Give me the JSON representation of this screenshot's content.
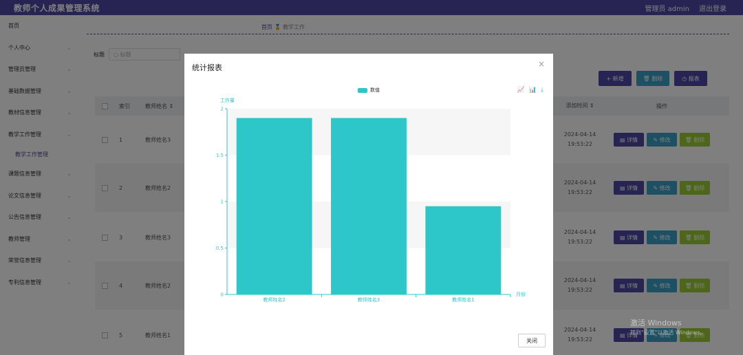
{
  "header": {
    "title": "教师个人成果管理系统",
    "admin": "管理员 admin",
    "logout": "退出登录"
  },
  "sidebar": {
    "items": [
      {
        "label": "首页",
        "chev": ""
      },
      {
        "label": "个人中心",
        "chev": "⌄"
      },
      {
        "label": "管理员管理",
        "chev": "⌄"
      },
      {
        "label": "基础数据管理",
        "chev": "⌄"
      },
      {
        "label": "教材信息管理",
        "chev": "⌄"
      },
      {
        "label": "教学工作管理",
        "chev": "⌄"
      }
    ],
    "sub_item": "教学工作管理",
    "items2": [
      {
        "label": "课题信息管理",
        "chev": "⌄"
      },
      {
        "label": "论文信息管理",
        "chev": "⌄"
      },
      {
        "label": "公告信息管理",
        "chev": "⌄"
      },
      {
        "label": "教师管理",
        "chev": "⌄"
      },
      {
        "label": "荣誉信息管理",
        "chev": "⌄"
      },
      {
        "label": "专利信息管理",
        "chev": "⌄"
      }
    ]
  },
  "breadcrumb": {
    "home": "首页",
    "sep": "🏅",
    "current": "教学工作"
  },
  "search": {
    "label": "标题",
    "placeholder": "标题"
  },
  "toolbar": {
    "add": "+ 新增",
    "delete": "🗑 删除",
    "report": "◷ 报表"
  },
  "table": {
    "headers": {
      "index": "索引",
      "name": "教师姓名 ⇕",
      "time": "添加时间 ⇕",
      "ops": "操作"
    },
    "rows": [
      {
        "index": "1",
        "name": "教师姓名3",
        "time": "2024-04-14 19:53:22"
      },
      {
        "index": "2",
        "name": "教师姓名2",
        "time": "2024-04-14 19:53:22"
      },
      {
        "index": "3",
        "name": "教师姓名3",
        "time": "2024-04-14 19:53:22"
      },
      {
        "index": "4",
        "name": "教师姓名2",
        "time": "2024-04-14 19:53:22"
      },
      {
        "index": "5",
        "name": "教师姓名1",
        "time": "2024-04-14 19:53:22"
      }
    ],
    "op_labels": {
      "detail": "▤ 详情",
      "edit": "✎ 修改",
      "delete": "🗑 删除"
    }
  },
  "modal": {
    "title": "统计报表",
    "close_x": "×",
    "close_button": "关闭"
  },
  "chart_tools": {
    "line": "📈",
    "bar": "📊",
    "save": "⤓"
  },
  "watermark": {
    "line1": "激活 Windows",
    "line2": "转到\"设置\"以激活 Windows。"
  },
  "colors": {
    "accent": "#4e49a6",
    "bar": "#2ec7c9",
    "axis": "#2ec7c9"
  },
  "chart_data": {
    "type": "bar",
    "categories": [
      "教师姓名2",
      "教师姓名3",
      "教师姓名1"
    ],
    "series": [
      {
        "name": "数值",
        "values": [
          1.9,
          1.9,
          0.95
        ]
      }
    ],
    "ylabel": "工作量",
    "xlabel": "月份",
    "ylim": [
      0,
      2
    ],
    "yticks": [
      "0",
      "0.5",
      "1",
      "1.5",
      "2"
    ],
    "legend_position": "top-center",
    "grid": "striped"
  }
}
